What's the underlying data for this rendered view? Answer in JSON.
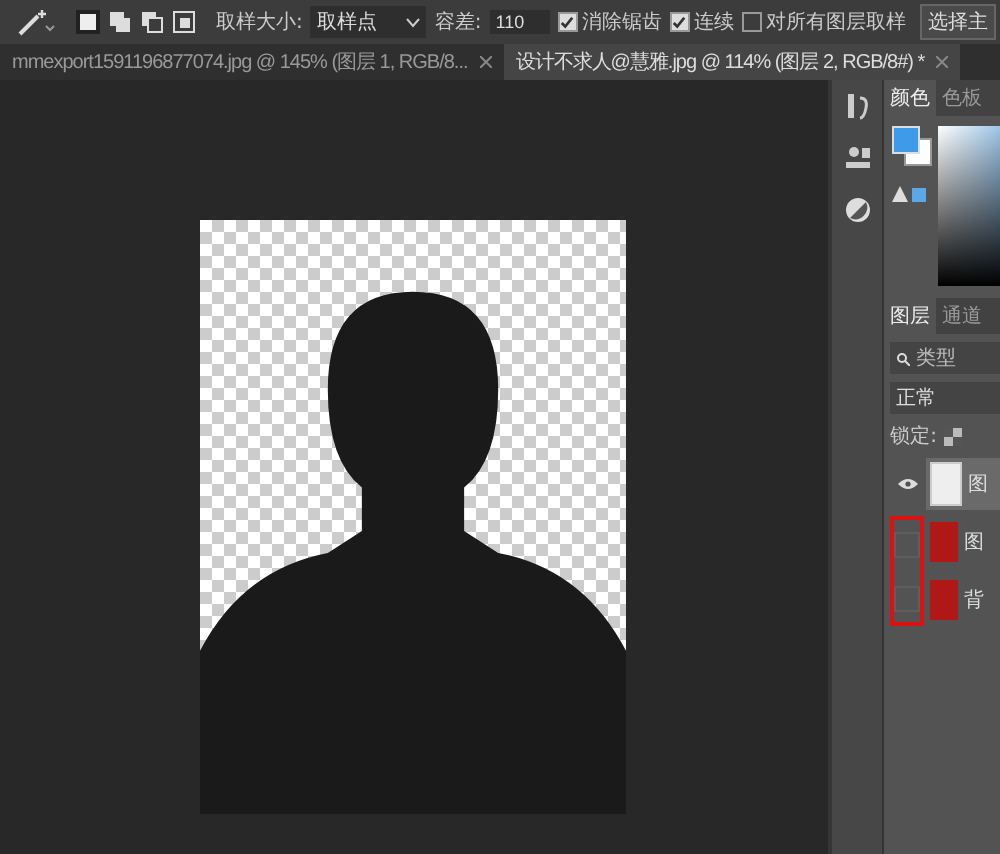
{
  "options_bar": {
    "sample_size_label": "取样大小:",
    "sample_size_value": "取样点",
    "tolerance_label": "容差:",
    "tolerance_value": "110",
    "checkboxes": [
      {
        "label": "消除锯齿",
        "checked": true
      },
      {
        "label": "连续",
        "checked": true
      },
      {
        "label": "对所有图层取样",
        "checked": false
      }
    ],
    "select_subject_button": "选择主"
  },
  "document_tabs": [
    {
      "title": "mmexport1591196877074.jpg @ 145% (图层 1, RGB/8...",
      "selected": false
    },
    {
      "title": "设计不求人@慧雅.jpg @ 114% (图层 2, RGB/8#) *",
      "selected": true
    }
  ],
  "color_panel": {
    "tabs": [
      {
        "label": "颜色",
        "selected": true
      },
      {
        "label": "色板",
        "selected": false
      }
    ]
  },
  "layers_panel": {
    "tabs": [
      {
        "label": "图层",
        "selected": true
      },
      {
        "label": "通道",
        "selected": false
      }
    ],
    "filter_placeholder": "类型",
    "blend_mode": "正常",
    "lock_label": "锁定:",
    "layers": [
      {
        "name": "图",
        "visible": true,
        "selected": true
      },
      {
        "name": "图",
        "visible": false,
        "selected": false
      },
      {
        "name": "背",
        "visible": false,
        "selected": false
      }
    ]
  }
}
